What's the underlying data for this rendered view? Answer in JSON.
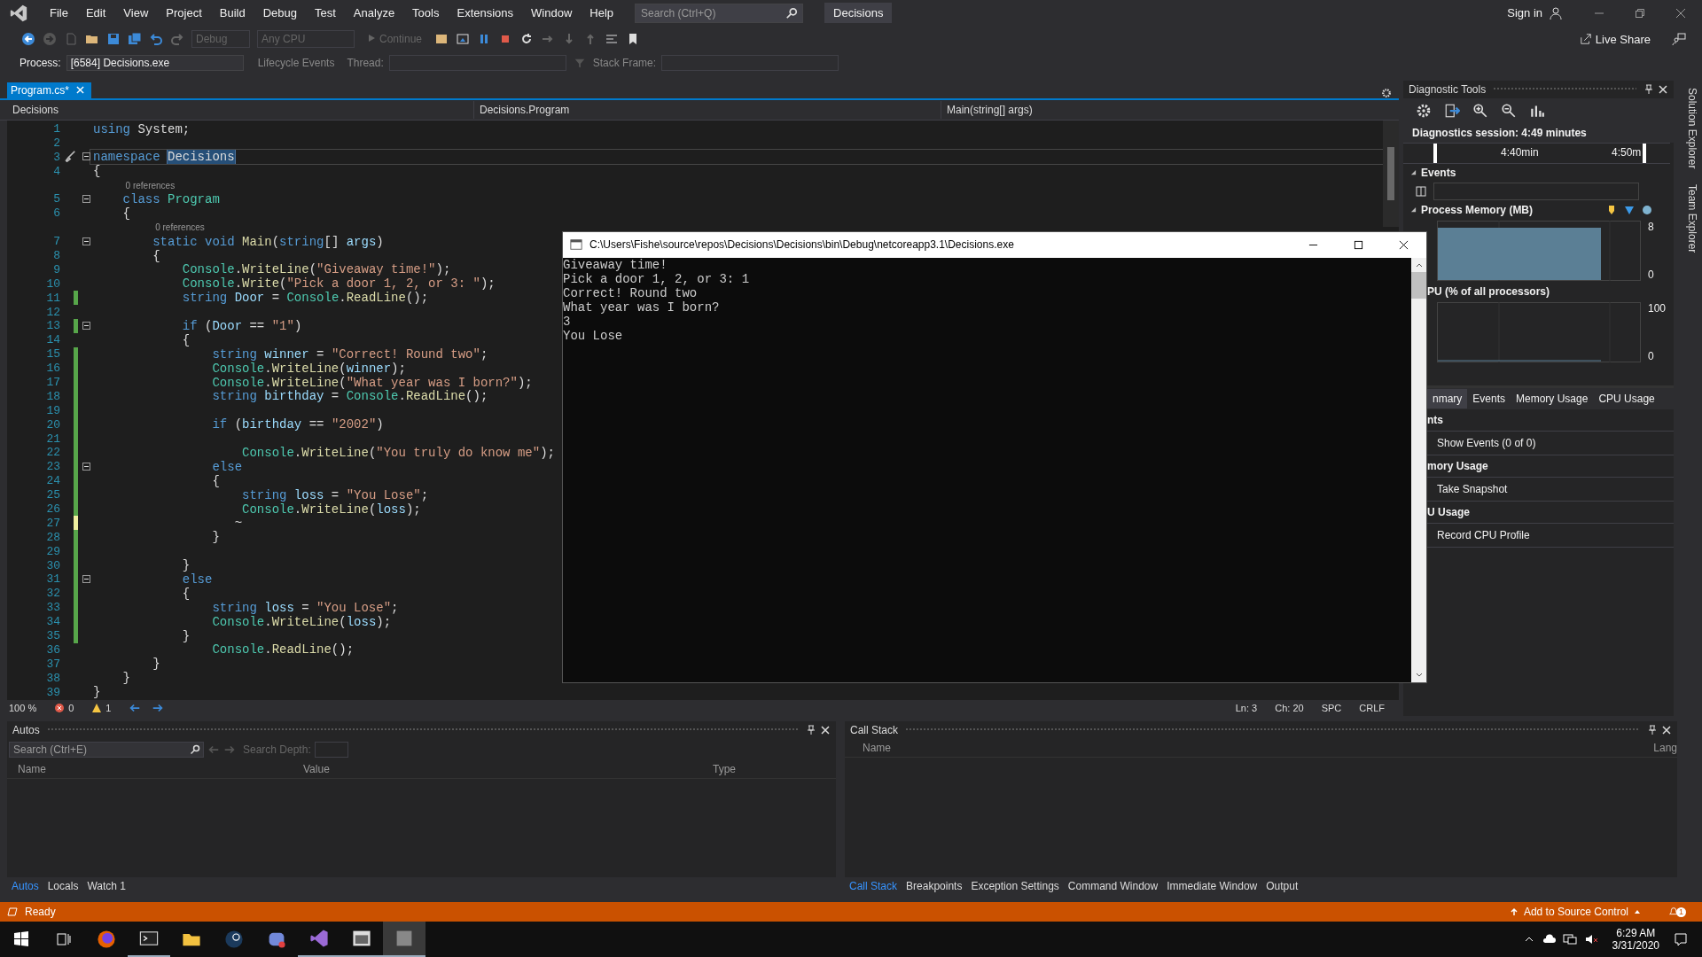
{
  "menu": {
    "items": [
      "File",
      "Edit",
      "View",
      "Project",
      "Build",
      "Debug",
      "Test",
      "Analyze",
      "Tools",
      "Extensions",
      "Window",
      "Help"
    ],
    "search": {
      "placeholder": "Search (Ctrl+Q)"
    },
    "solution": "Decisions",
    "sign_in": "Sign in"
  },
  "toolbar": {
    "dropdowns": [
      {
        "label": "Debug",
        "disabled": true
      },
      {
        "label": "Any CPU",
        "disabled": true
      }
    ],
    "continue": {
      "label": "Continue",
      "disabled": true
    },
    "live_share": "Live Share"
  },
  "process_bar": {
    "process_label": "Process:",
    "process": "[6584] Decisions.exe",
    "lifecycle": "Lifecycle Events",
    "thread_label": "Thread:",
    "stack_frame_label": "Stack Frame:"
  },
  "editor": {
    "tabs": [
      {
        "label": "Program.cs*",
        "selected": true
      }
    ],
    "nav": [
      "Decisions",
      "Decisions.Program",
      "Main(string[] args)"
    ],
    "lines": [
      {
        "kind": "code",
        "n": "1",
        "c": [
          {
            "kind": "kw",
            "text": "using "
          },
          {
            "kind": "p",
            "text": "System;"
          }
        ]
      },
      {
        "kind": "code",
        "n": "2"
      },
      {
        "kind": "code",
        "n": "3",
        "fold": true,
        "current": true,
        "c": [
          {
            "kind": "kw",
            "text": "namespace "
          },
          {
            "kind": "sel",
            "text": "Decisions"
          }
        ]
      },
      {
        "kind": "code",
        "n": "4",
        "c": [
          {
            "kind": "p",
            "text": "{"
          }
        ]
      },
      {
        "kind": "lens",
        "text": "0 references"
      },
      {
        "kind": "code",
        "n": "5",
        "fold": true,
        "c": [
          {
            "kind": "kw",
            "text": "    class "
          },
          {
            "kind": "ty",
            "text": "Program"
          }
        ]
      },
      {
        "kind": "code",
        "n": "6",
        "c": [
          {
            "kind": "p",
            "text": "    {"
          }
        ]
      },
      {
        "kind": "lens",
        "text": "0 references"
      },
      {
        "kind": "code",
        "n": "7",
        "fold": true,
        "c": [
          {
            "kind": "kw",
            "text": "        static "
          },
          {
            "kind": "kw",
            "text": "void "
          },
          {
            "kind": "fn",
            "text": "Main"
          },
          {
            "kind": "p",
            "text": "("
          },
          {
            "kind": "kw",
            "text": "string"
          },
          {
            "kind": "p",
            "text": "[] "
          },
          {
            "kind": "va",
            "text": "args"
          },
          {
            "kind": "p",
            "text": ")"
          }
        ]
      },
      {
        "kind": "code",
        "n": "8",
        "c": [
          {
            "kind": "p",
            "text": "        {"
          }
        ]
      },
      {
        "kind": "code",
        "n": "9",
        "c": [
          {
            "kind": "ty",
            "text": "            Console"
          },
          {
            "kind": "p",
            "text": "."
          },
          {
            "kind": "fn",
            "text": "WriteLine"
          },
          {
            "kind": "p",
            "text": "("
          },
          {
            "kind": "st",
            "text": "\"Giveaway time!\""
          },
          {
            "kind": "p",
            "text": ");"
          }
        ]
      },
      {
        "kind": "code",
        "n": "10",
        "c": [
          {
            "kind": "ty",
            "text": "            Console"
          },
          {
            "kind": "p",
            "text": "."
          },
          {
            "kind": "fn",
            "text": "Write"
          },
          {
            "kind": "p",
            "text": "("
          },
          {
            "kind": "st",
            "text": "\"Pick a door 1, 2, or 3: \""
          },
          {
            "kind": "p",
            "text": ");"
          }
        ]
      },
      {
        "kind": "code",
        "n": "11",
        "modified": true,
        "saved": true,
        "c": [
          {
            "kind": "kw",
            "text": "            string "
          },
          {
            "kind": "va",
            "text": "Door"
          },
          {
            "kind": "p",
            "text": " = "
          },
          {
            "kind": "ty",
            "text": "Console"
          },
          {
            "kind": "p",
            "text": "."
          },
          {
            "kind": "fn",
            "text": "ReadLine"
          },
          {
            "kind": "p",
            "text": "();"
          }
        ]
      },
      {
        "kind": "code",
        "n": "12"
      },
      {
        "kind": "code",
        "n": "13",
        "modified": true,
        "saved": true,
        "fold": true,
        "c": [
          {
            "kind": "kw",
            "text": "            if"
          },
          {
            "kind": "p",
            "text": " ("
          },
          {
            "kind": "va",
            "text": "Door"
          },
          {
            "kind": "p",
            "text": " == "
          },
          {
            "kind": "st",
            "text": "\"1\""
          },
          {
            "kind": "p",
            "text": ")"
          }
        ]
      },
      {
        "kind": "code",
        "n": "14",
        "c": [
          {
            "kind": "p",
            "text": "            {"
          }
        ]
      },
      {
        "kind": "code",
        "n": "15",
        "modified": true,
        "saved": true,
        "c": [
          {
            "kind": "kw",
            "text": "                string "
          },
          {
            "kind": "va",
            "text": "winner"
          },
          {
            "kind": "p",
            "text": " = "
          },
          {
            "kind": "st",
            "text": "\"Correct! Round two\""
          },
          {
            "kind": "p",
            "text": ";"
          }
        ]
      },
      {
        "kind": "code",
        "n": "16",
        "modified": true,
        "saved": true,
        "c": [
          {
            "kind": "ty",
            "text": "                Console"
          },
          {
            "kind": "p",
            "text": "."
          },
          {
            "kind": "fn",
            "text": "WriteLine"
          },
          {
            "kind": "p",
            "text": "("
          },
          {
            "kind": "va",
            "text": "winner"
          },
          {
            "kind": "p",
            "text": ");"
          }
        ]
      },
      {
        "kind": "code",
        "n": "17",
        "modified": true,
        "saved": true,
        "c": [
          {
            "kind": "ty",
            "text": "                Console"
          },
          {
            "kind": "p",
            "text": "."
          },
          {
            "kind": "fn",
            "text": "WriteLine"
          },
          {
            "kind": "p",
            "text": "("
          },
          {
            "kind": "st",
            "text": "\"What year was I born?\""
          },
          {
            "kind": "p",
            "text": ");"
          }
        ]
      },
      {
        "kind": "code",
        "n": "18",
        "modified": true,
        "saved": true,
        "c": [
          {
            "kind": "kw",
            "text": "                string "
          },
          {
            "kind": "va",
            "text": "birthday"
          },
          {
            "kind": "p",
            "text": " = "
          },
          {
            "kind": "ty",
            "text": "Console"
          },
          {
            "kind": "p",
            "text": "."
          },
          {
            "kind": "fn",
            "text": "ReadLine"
          },
          {
            "kind": "p",
            "text": "();"
          }
        ]
      },
      {
        "kind": "code",
        "n": "19",
        "modified": true,
        "saved": true
      },
      {
        "kind": "code",
        "n": "20",
        "modified": true,
        "saved": true,
        "c": [
          {
            "kind": "kw",
            "text": "                if"
          },
          {
            "kind": "p",
            "text": " ("
          },
          {
            "kind": "va",
            "text": "birthday"
          },
          {
            "kind": "p",
            "text": " == "
          },
          {
            "kind": "st",
            "text": "\"2002\""
          },
          {
            "kind": "p",
            "text": ")"
          }
        ]
      },
      {
        "kind": "code",
        "n": "21",
        "modified": true,
        "saved": true
      },
      {
        "kind": "code",
        "n": "22",
        "modified": true,
        "saved": true,
        "c": [
          {
            "kind": "ty",
            "text": "                    Console"
          },
          {
            "kind": "p",
            "text": "."
          },
          {
            "kind": "fn",
            "text": "WriteLine"
          },
          {
            "kind": "p",
            "text": "("
          },
          {
            "kind": "st",
            "text": "\"You truly do know me\""
          },
          {
            "kind": "p",
            "text": ");"
          }
        ]
      },
      {
        "kind": "code",
        "n": "23",
        "modified": true,
        "saved": true,
        "fold": true,
        "c": [
          {
            "kind": "kw",
            "text": "                else"
          }
        ]
      },
      {
        "kind": "code",
        "n": "24",
        "modified": true,
        "saved": true,
        "c": [
          {
            "kind": "p",
            "text": "                {"
          }
        ]
      },
      {
        "kind": "code",
        "n": "25",
        "modified": true,
        "saved": true,
        "c": [
          {
            "kind": "kw",
            "text": "                    string "
          },
          {
            "kind": "va",
            "text": "loss"
          },
          {
            "kind": "p",
            "text": " = "
          },
          {
            "kind": "st",
            "text": "\"You Lose\""
          },
          {
            "kind": "p",
            "text": ";"
          }
        ]
      },
      {
        "kind": "code",
        "n": "26",
        "modified": true,
        "saved": true,
        "c": [
          {
            "kind": "ty",
            "text": "                    Console"
          },
          {
            "kind": "p",
            "text": "."
          },
          {
            "kind": "fn",
            "text": "WriteLine"
          },
          {
            "kind": "p",
            "text": "("
          },
          {
            "kind": "va",
            "text": "loss"
          },
          {
            "kind": "p",
            "text": ");"
          }
        ]
      },
      {
        "kind": "code",
        "n": "27",
        "modified": true,
        "saved": false,
        "c": [
          {
            "kind": "p",
            "text": "                   ~"
          }
        ]
      },
      {
        "kind": "code",
        "n": "28",
        "modified": true,
        "saved": true,
        "c": [
          {
            "kind": "p",
            "text": "                }"
          }
        ]
      },
      {
        "kind": "code",
        "n": "29",
        "modified": true,
        "saved": true
      },
      {
        "kind": "code",
        "n": "30",
        "modified": true,
        "saved": true,
        "c": [
          {
            "kind": "p",
            "text": "            }"
          }
        ]
      },
      {
        "kind": "code",
        "n": "31",
        "modified": true,
        "saved": true,
        "fold": true,
        "c": [
          {
            "kind": "kw",
            "text": "            else"
          }
        ]
      },
      {
        "kind": "code",
        "n": "32",
        "modified": true,
        "saved": true,
        "c": [
          {
            "kind": "p",
            "text": "            {"
          }
        ]
      },
      {
        "kind": "code",
        "n": "33",
        "modified": true,
        "saved": true,
        "c": [
          {
            "kind": "kw",
            "text": "                string "
          },
          {
            "kind": "va",
            "text": "loss"
          },
          {
            "kind": "p",
            "text": " = "
          },
          {
            "kind": "st",
            "text": "\"You Lose\""
          },
          {
            "kind": "p",
            "text": ";"
          }
        ]
      },
      {
        "kind": "code",
        "n": "34",
        "modified": true,
        "saved": true,
        "c": [
          {
            "kind": "ty",
            "text": "                Console"
          },
          {
            "kind": "p",
            "text": "."
          },
          {
            "kind": "fn",
            "text": "WriteLine"
          },
          {
            "kind": "p",
            "text": "("
          },
          {
            "kind": "va",
            "text": "loss"
          },
          {
            "kind": "p",
            "text": ");"
          }
        ]
      },
      {
        "kind": "code",
        "n": "35",
        "modified": true,
        "saved": true,
        "c": [
          {
            "kind": "p",
            "text": "            }"
          }
        ]
      },
      {
        "kind": "code",
        "n": "36",
        "c": [
          {
            "kind": "ty",
            "text": "                Console"
          },
          {
            "kind": "p",
            "text": "."
          },
          {
            "kind": "fn",
            "text": "ReadLine"
          },
          {
            "kind": "p",
            "text": "();"
          }
        ]
      },
      {
        "kind": "code",
        "n": "37",
        "c": [
          {
            "kind": "p",
            "text": "        }"
          }
        ]
      },
      {
        "kind": "code",
        "n": "38",
        "c": [
          {
            "kind": "p",
            "text": "    }"
          }
        ]
      },
      {
        "kind": "code",
        "n": "39",
        "c": [
          {
            "kind": "p",
            "text": "}"
          }
        ]
      }
    ],
    "status": {
      "zoom": "100 %",
      "errors": "0",
      "warnings": "1",
      "line": "Ln: 3",
      "char": "Ch: 20",
      "spacing": "SPC",
      "eol": "CRLF"
    }
  },
  "console": {
    "title": "C:\\Users\\Fishe\\source\\repos\\Decisions\\Decisions\\bin\\Debug\\netcoreapp3.1\\Decisions.exe",
    "output": [
      "Giveaway time!",
      "Pick a door 1, 2, or 3: 1",
      "Correct! Round two",
      "What year was I born?",
      "3",
      "You Lose"
    ]
  },
  "diagnostics": {
    "title": "Diagnostic Tools",
    "session": "Diagnostics session: 4:49 minutes",
    "timeline": [
      "4:40min",
      "4:50m"
    ],
    "events_heading": "Events",
    "memory_heading": "Process Memory (MB)",
    "memory_axis": [
      "8",
      "0"
    ],
    "cpu_heading": "PU (% of all processors)",
    "cpu_axis": [
      "100",
      "0"
    ],
    "tabs": [
      {
        "label": "nmary",
        "selected": true
      },
      {
        "label": "Events",
        "selected": false
      },
      {
        "label": "Memory Usage",
        "selected": false
      },
      {
        "label": "CPU Usage",
        "selected": false
      }
    ],
    "sections": [
      {
        "heading": "nts",
        "action": "Show Events (0 of 0)"
      },
      {
        "heading": "mory Usage",
        "action": "Take Snapshot"
      },
      {
        "heading": "U Usage",
        "action": "Record CPU Profile"
      }
    ]
  },
  "side_tabs": [
    "Solution Explorer",
    "Team Explorer"
  ],
  "autos": {
    "title": "Autos",
    "search": {
      "placeholder": "Search (Ctrl+E)"
    },
    "depth_label": "Search Depth:",
    "columns": [
      "Name",
      "Value",
      "Type"
    ],
    "tabs": [
      {
        "label": "Autos",
        "selected": true
      },
      {
        "label": "Locals",
        "selected": false
      },
      {
        "label": "Watch 1",
        "selected": false
      }
    ]
  },
  "call_stack": {
    "title": "Call Stack",
    "columns": [
      "Name",
      "Lang"
    ],
    "tabs": [
      {
        "label": "Call Stack",
        "selected": true
      },
      {
        "label": "Breakpoints",
        "selected": false
      },
      {
        "label": "Exception Settings",
        "selected": false
      },
      {
        "label": "Command Window",
        "selected": false
      },
      {
        "label": "Immediate Window",
        "selected": false
      },
      {
        "label": "Output",
        "selected": false
      }
    ]
  },
  "status_bar": {
    "state": "Ready",
    "source_control": "Add to Source Control",
    "notifications": "1"
  },
  "taskbar": {
    "apps": [
      {
        "running": false,
        "selected": false
      },
      {
        "running": true,
        "selected": false
      },
      {
        "running": false,
        "selected": false
      },
      {
        "running": false,
        "selected": false
      },
      {
        "running": false,
        "selected": false
      },
      {
        "running": true,
        "selected": false
      },
      {
        "running": true,
        "selected": false
      },
      {
        "running": true,
        "selected": true
      }
    ],
    "time": "6:29 AM",
    "date": "3/31/2020"
  }
}
